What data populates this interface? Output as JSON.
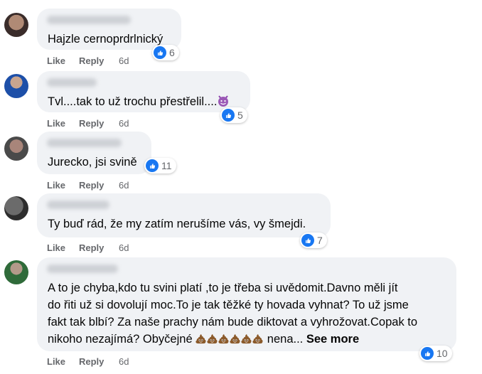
{
  "actions": {
    "like": "Like",
    "reply": "Reply"
  },
  "comments": [
    {
      "text": "Hajzle cernoprdrlnický",
      "reactions": "6",
      "time": "6d"
    },
    {
      "text": "Tvl....tak to už trochu přestřelil....",
      "reactions": "5",
      "time": "6d",
      "emoji": "smiling-devil-icon"
    },
    {
      "text": "Jurecko, jsi svině",
      "reactions": "11",
      "time": "6d"
    },
    {
      "text": "Ty buď rád, že my zatím nerušíme vás, vy šmejdi.",
      "reactions": "7",
      "time": "6d"
    },
    {
      "lines": [
        "A to je chyba,kdo tu svini platí ,to je třeba si uvědomit.Davno měli jít",
        "do řiti už si dovolují moc.To je tak těžké ty hovada vyhnat? To už jsme",
        "fakt tak blbí? Za naše prachy nám bude diktovat a vyhrožovat.Copak to",
        "nikoho nezajímá? Obyčejné"
      ],
      "tail": " nena... ",
      "see_more": "See more",
      "reactions": "10",
      "time": "6d"
    }
  ],
  "colors": {
    "accent": "#1877f2",
    "bubble": "#f0f2f5",
    "meta": "#65676b"
  }
}
